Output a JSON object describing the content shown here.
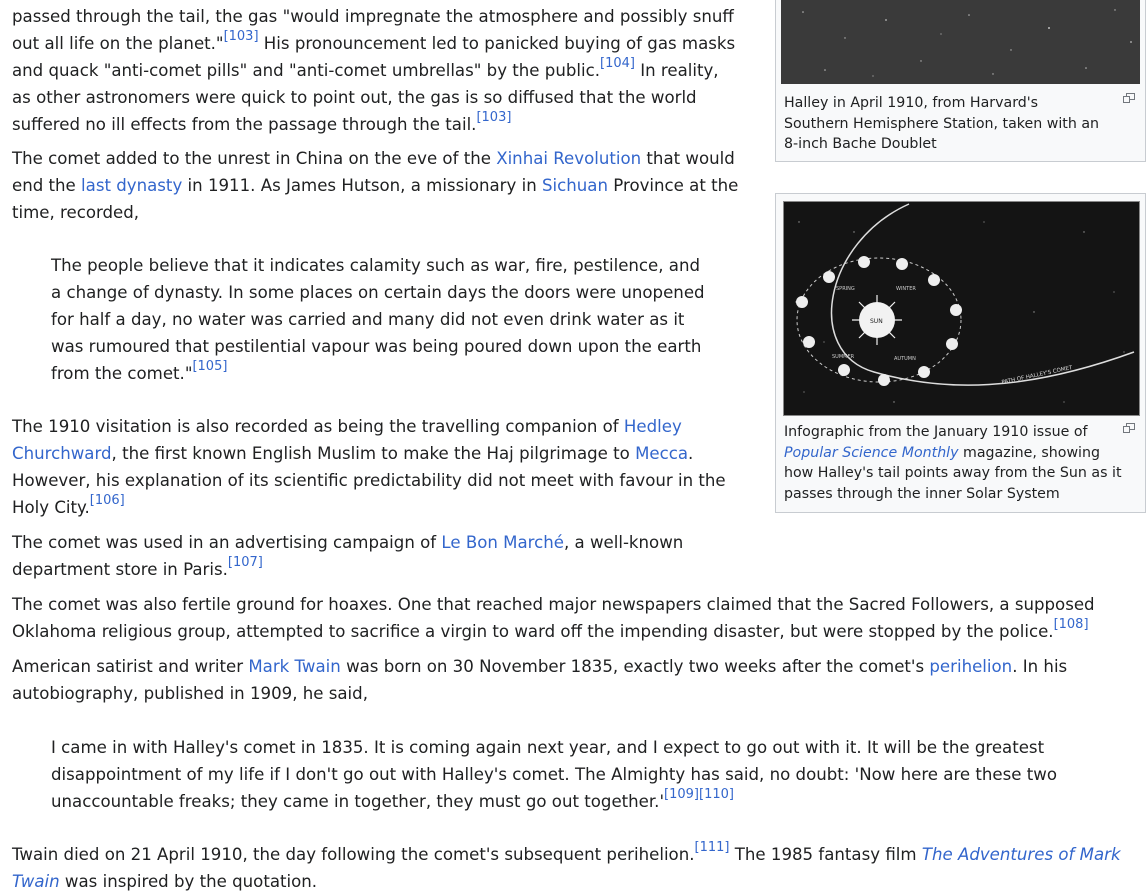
{
  "colors": {
    "link": "#3366cc",
    "text": "#202122",
    "thumb_border": "#c8ccd1",
    "thumb_bg": "#f8f9fa"
  },
  "p1": {
    "l1": "passed through the tail, the gas \"would impregnate the atmosphere and possibly snuff",
    "l2a": "out all life on the planet.\"",
    "ref103a": "[103]",
    "l2b": " His pronouncement led to panicked buying of gas masks",
    "l3a": "and quack \"anti-comet pills\" and \"anti-comet umbrellas\" by the public.",
    "ref104": "[104]",
    "l3b": " In reality,",
    "l4": "as other astronomers were quick to point out, the gas is so diffused that the world",
    "l5a": "suffered no ill effects from the passage through the tail.",
    "ref103b": "[103]"
  },
  "p2": {
    "l1a": "The comet added to the unrest in China on the eve of the ",
    "link_xinhai": "Xinhai Revolution",
    "l1b": " that would",
    "l2a": "end the ",
    "link_dynasty": "last dynasty",
    "l2b": " in 1911. As James Hutson, a missionary in ",
    "link_sichuan": "Sichuan",
    "l2c": " Province at the",
    "l3": "time, recorded,"
  },
  "q1": {
    "l1": "The people believe that it indicates calamity such as war, fire, pestilence, and",
    "l2": "a change of dynasty. In some places on certain days the doors were unopened",
    "l3": "for half a day, no water was carried and many did not even drink water as it",
    "l4": "was rumoured that pestilential vapour was being poured down upon the earth",
    "l5a": "from the comet.\"",
    "ref105": "[105]"
  },
  "p3": {
    "l1a": "The 1910 visitation is also recorded as being the travelling companion of ",
    "link_hedley1": "Hedley",
    "link_hedley2": "Churchward",
    "l2a": ", the first known English Muslim to make the Haj pilgrimage to ",
    "link_mecca": "Mecca",
    "l2b": ".",
    "l3": "However, his explanation of its scientific predictability did not meet with favour in the",
    "l4a": "Holy City.",
    "ref106": "[106]"
  },
  "p4": {
    "l1a": "The comet was used in an advertising campaign of ",
    "link_bonmarche": "Le Bon Marché",
    "l1b": ", a well-known",
    "l2a": "department store in Paris.",
    "ref107": "[107]"
  },
  "p5": {
    "l1": "The comet was also fertile ground for hoaxes. One that reached major newspapers claimed that the Sacred Followers, a supposed",
    "l2a": "Oklahoma religious group, attempted to sacrifice a virgin to ward off the impending disaster, but were stopped by the police.",
    "ref108": "[108]"
  },
  "p6": {
    "l1a": "American satirist and writer ",
    "link_twain": "Mark Twain",
    "l1b": " was born on 30 November 1835, exactly two weeks after the comet's ",
    "link_perihelion": "perihelion",
    "l1c": ". In his",
    "l2": "autobiography, published in 1909, he said,"
  },
  "q2": {
    "l1": "I came in with Halley's comet in 1835. It is coming again next year, and I expect to go out with it. It will be the greatest",
    "l2": "disappointment of my life if I don't go out with Halley's comet. The Almighty has said, no doubt: 'Now here are these two",
    "l3a": "unaccountable freaks; they came in together, they must go out together.'",
    "ref109": "[109]",
    "ref110": "[110]"
  },
  "p7": {
    "l1a": "Twain died on 21 April 1910, the day following the comet's subsequent perihelion.",
    "ref111": "[111]",
    "l1b": " The 1985 fantasy film ",
    "link_film1": "The Adventures of Mark",
    "link_film2": "Twain",
    "l2b": " was inspired by the quotation."
  },
  "thumb1": {
    "cap1": "Halley in April 1910, from Harvard's",
    "cap2": "Southern Hemisphere Station, taken with an",
    "cap3": "8-inch Bache Doublet"
  },
  "thumb2": {
    "cap1": "Infographic from the January 1910 issue of",
    "cap2_link": "Popular Science Monthly",
    "cap2b": " magazine, showing",
    "cap3": "how Halley's tail points away from the Sun as it",
    "cap4": "passes through the inner Solar System",
    "label_spring": "SPRING",
    "label_winter": "WINTER",
    "label_summer": "SUMMER",
    "label_autumn": "AUTUMN",
    "label_sun": "SUN",
    "label_path": "PATH OF HALLEY'S COMET"
  }
}
